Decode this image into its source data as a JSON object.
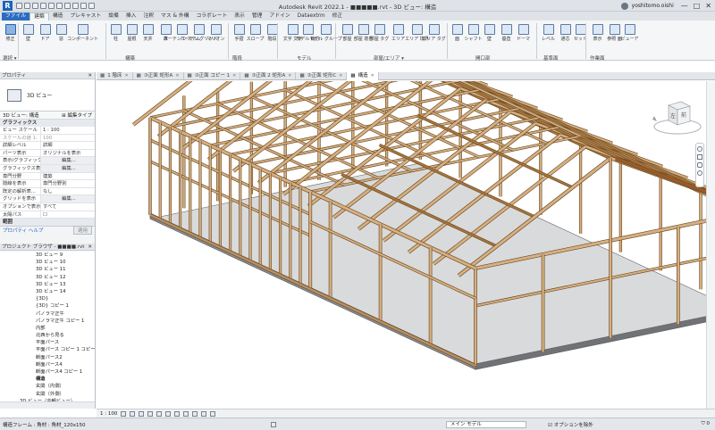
{
  "app": {
    "logo_letter": "R",
    "title": "Autodesk Revit 2022.1 - ■■■■■.rvt - 3D ビュー: 構造",
    "user": "yoshitomo.oishi",
    "window_controls": [
      "—",
      "□",
      "✕"
    ]
  },
  "ribbon_tabs": [
    "ファイル",
    "建築",
    "構造",
    "プレキャスト",
    "設備",
    "挿入",
    "注釈",
    "マス & 外構",
    "コラボレート",
    "表示",
    "管理",
    "アドイン",
    "Dataextrm",
    "修正"
  ],
  "ribbon": {
    "buttons": [
      {
        "label": "修正",
        "sel": true
      },
      {
        "label": "壁"
      },
      {
        "label": "ドア"
      },
      {
        "label": "窓"
      },
      {
        "label": "コンポーネント"
      },
      {
        "label": "柱"
      },
      {
        "label": "屋根"
      },
      {
        "label": "天井"
      },
      {
        "label": "床"
      },
      {
        "label": "カーテン システム"
      },
      {
        "label": "カーテン グリッド"
      },
      {
        "label": "マリオン"
      },
      {
        "label": "手摺"
      },
      {
        "label": "スロープ"
      },
      {
        "label": "階段"
      },
      {
        "label": "文字 文字"
      },
      {
        "label": "モデル 線分"
      },
      {
        "label": "モデル グループ"
      },
      {
        "label": "部屋"
      },
      {
        "label": "部屋 境界"
      },
      {
        "label": "部屋 タグ"
      },
      {
        "label": "エリア"
      },
      {
        "label": "エリア 境界"
      },
      {
        "label": "エリア タグ"
      },
      {
        "label": "面"
      },
      {
        "label": "シャフト"
      },
      {
        "label": "壁"
      },
      {
        "label": "垂直"
      },
      {
        "label": "ドーマ"
      },
      {
        "label": "レベル"
      },
      {
        "label": "通芯"
      },
      {
        "label": "セット"
      },
      {
        "label": "表示"
      },
      {
        "label": "参照 面"
      },
      {
        "label": "ビューア"
      }
    ],
    "panels": [
      "選択 ▾",
      "構築",
      "階段",
      "モデル",
      "部屋/エリア ▾",
      "開口部",
      "基準面",
      "作業面"
    ]
  },
  "doc_tabs": [
    {
      "label": "1 階床",
      "active": false
    },
    {
      "label": "③正面 矩形A",
      "active": false
    },
    {
      "label": "③正面 コピー 1",
      "active": false
    },
    {
      "label": "③正面 2 矩形A",
      "active": false
    },
    {
      "label": "③正面 矩形C",
      "active": false
    },
    {
      "label": "構造",
      "active": true
    }
  ],
  "properties": {
    "header": "プロパティ",
    "type_name": "3D ビュー",
    "view_selector": "3D ビュー: 構造",
    "edit_type": "編集タイプ",
    "group": "グラフィックス",
    "rows": [
      {
        "k": "ビュー スケール",
        "v": "1 : 100",
        "btn": false,
        "dis": false
      },
      {
        "k": "スケールの値 1:",
        "v": "100",
        "btn": false,
        "dis": true
      },
      {
        "k": "詳細レベル",
        "v": "詳細",
        "btn": false,
        "dis": false
      },
      {
        "k": "パーツ表示",
        "v": "オリジナルを表示",
        "btn": false,
        "dis": false
      },
      {
        "k": "表示/グラフィック...",
        "v": "編集...",
        "btn": true,
        "dis": false
      },
      {
        "k": "グラフィックス表...",
        "v": "編集...",
        "btn": true,
        "dis": false
      },
      {
        "k": "専門分野",
        "v": "建築",
        "btn": false,
        "dis": false
      },
      {
        "k": "隠線を表示",
        "v": "専門分野別",
        "btn": false,
        "dis": false
      },
      {
        "k": "既定の解析表...",
        "v": "なし",
        "btn": false,
        "dis": false
      },
      {
        "k": "グリッドを表示",
        "v": "編集...",
        "btn": true,
        "dis": false
      },
      {
        "k": "オプションで表示",
        "v": "すべて",
        "btn": false,
        "dis": false
      },
      {
        "k": "太陽パス",
        "v": "☐",
        "btn": false,
        "dis": false
      }
    ],
    "group2": "範囲",
    "help": "プロパティ ヘルプ",
    "apply": "適用"
  },
  "browser": {
    "header": "プロジェクト ブラウザ - ■■■■.rvt",
    "items": [
      {
        "label": "3D ビュー 9",
        "bold": false
      },
      {
        "label": "3D ビュー 10",
        "bold": false
      },
      {
        "label": "3D ビュー 11",
        "bold": false
      },
      {
        "label": "3D ビュー 12",
        "bold": false
      },
      {
        "label": "3D ビュー 13",
        "bold": false
      },
      {
        "label": "3D ビュー 14",
        "bold": false
      },
      {
        "label": "{3D}",
        "bold": false
      },
      {
        "label": "{3D} コピー 1",
        "bold": false
      },
      {
        "label": "パノラマ正午",
        "bold": false
      },
      {
        "label": "パノラマ正午 コピー 1",
        "bold": false
      },
      {
        "label": "内部",
        "bold": false
      },
      {
        "label": "北西から見る",
        "bold": false
      },
      {
        "label": "平面パース",
        "bold": false
      },
      {
        "label": "平面パース コピー 1 コピー",
        "bold": false
      },
      {
        "label": "断面パース2",
        "bold": false
      },
      {
        "label": "断面パース4",
        "bold": false
      },
      {
        "label": "断面パース4 コピー 1",
        "bold": false
      },
      {
        "label": "構造",
        "bold": true
      },
      {
        "label": "玄関（内側）",
        "bold": false
      },
      {
        "label": "玄関（外側）",
        "bold": false
      },
      {
        "label": "3D ビュー（内観ビュー）",
        "bold": false
      }
    ]
  },
  "viewbar": {
    "scale": "1 : 100"
  },
  "statusbar": {
    "left": "構造フレーム : 角材 : 角材_120x150",
    "model": "メイン モデル",
    "option": "オプションを除外"
  },
  "viewcube": {
    "left": "左",
    "front": "前"
  },
  "colors": {
    "accent": "#2b6cc0",
    "lumber": "#d6b083",
    "lumber_dark": "#a7763e",
    "foundation": "#8b8d90"
  }
}
